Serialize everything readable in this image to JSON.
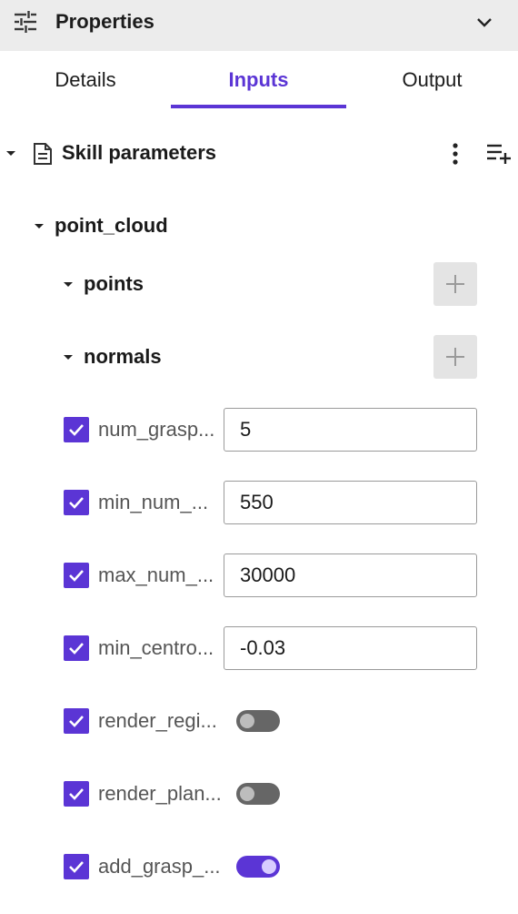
{
  "header": {
    "title": "Properties",
    "icon": "tune-icon",
    "collapse_icon": "chevron-down-icon"
  },
  "tabs": [
    {
      "label": "Details",
      "active": false
    },
    {
      "label": "Inputs",
      "active": true
    },
    {
      "label": "Output",
      "active": false
    }
  ],
  "accent_color": "#5b35d5",
  "skill_parameters": {
    "label": "Skill parameters",
    "point_cloud": {
      "label": "point_cloud",
      "children": [
        {
          "label": "points",
          "action": "add"
        },
        {
          "label": "normals",
          "action": "add"
        }
      ]
    },
    "params": [
      {
        "label": "num_grasp...",
        "checked": true,
        "type": "input",
        "value": "5"
      },
      {
        "label": "min_num_...",
        "checked": true,
        "type": "input",
        "value": "550"
      },
      {
        "label": "max_num_...",
        "checked": true,
        "type": "input",
        "value": "30000"
      },
      {
        "label": "min_centro...",
        "checked": true,
        "type": "input",
        "value": "-0.03"
      },
      {
        "label": "render_regi...",
        "checked": true,
        "type": "toggle",
        "on": false
      },
      {
        "label": "render_plan...",
        "checked": true,
        "type": "toggle",
        "on": false
      },
      {
        "label": "add_grasp_...",
        "checked": true,
        "type": "toggle",
        "on": true
      }
    ]
  }
}
